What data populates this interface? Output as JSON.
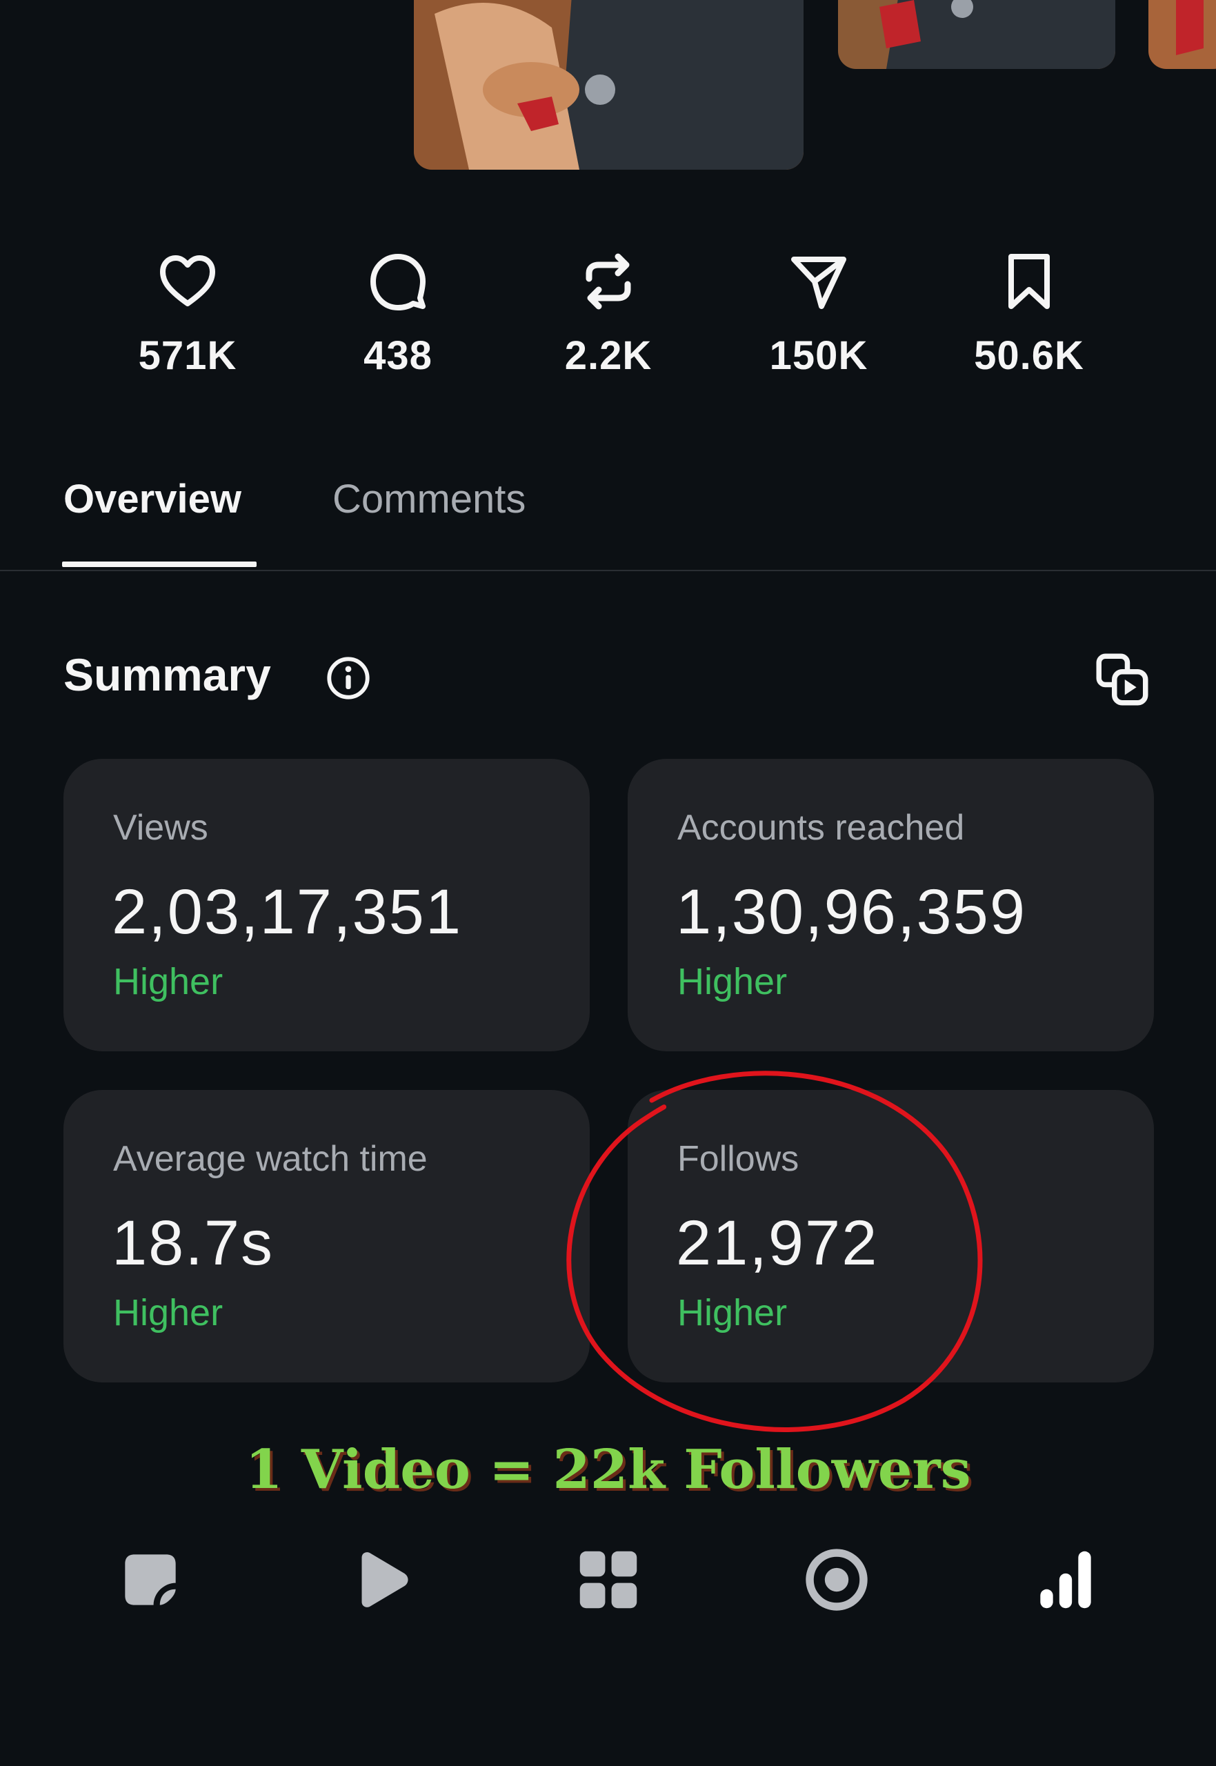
{
  "engagement": {
    "likes": "571K",
    "comments": "438",
    "reposts": "2.2K",
    "shares": "150K",
    "saves": "50.6K"
  },
  "tabs": {
    "overview": "Overview",
    "comments": "Comments"
  },
  "summary": {
    "title": "Summary"
  },
  "cards": {
    "views": {
      "label": "Views",
      "value": "2,03,17,351",
      "trend": "Higher"
    },
    "accounts_reached": {
      "label": "Accounts reached",
      "value": "1,30,96,359",
      "trend": "Higher"
    },
    "avg_watch_time": {
      "label": "Average watch time",
      "value": "18.7s",
      "trend": "Higher"
    },
    "follows": {
      "label": "Follows",
      "value": "21,972",
      "trend": "Higher"
    }
  },
  "caption": "1 Video = 22k Followers",
  "colors": {
    "background": "#0c1014",
    "card": "#202226",
    "trend_green": "#3fc060",
    "annotation_red": "#e0141c",
    "caption_green": "#82d44c"
  },
  "icons": {
    "likes": "heart-icon",
    "comments": "comment-bubble-icon",
    "reposts": "repost-icon",
    "shares": "send-icon",
    "saves": "bookmark-icon",
    "info": "info-icon",
    "copy": "copy-media-icon",
    "nav": [
      "notes-icon",
      "play-icon",
      "grid-icon",
      "record-icon",
      "insights-bars-icon"
    ]
  }
}
